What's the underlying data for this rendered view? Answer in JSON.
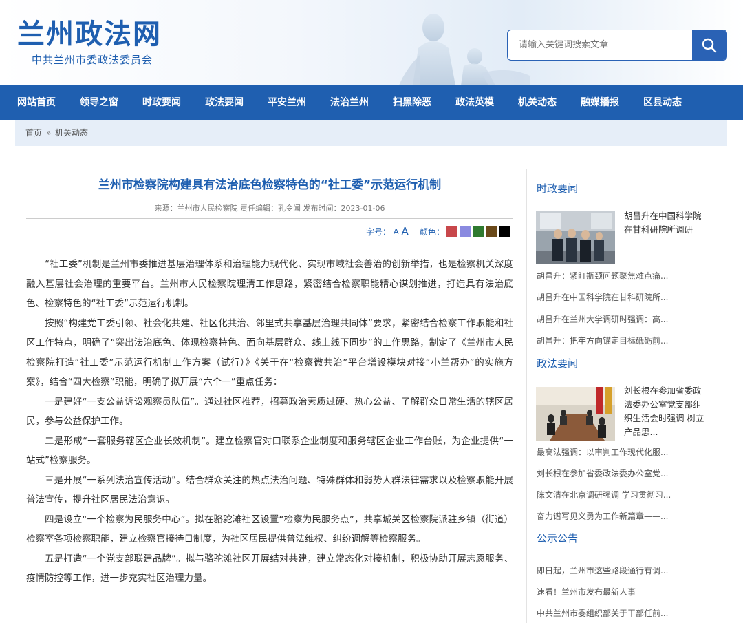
{
  "header": {
    "logo_title": "兰州政法网",
    "logo_subtitle": "中共兰州市委政法委员会",
    "search_placeholder": "请输入关键词搜索文章"
  },
  "nav": [
    "网站首页",
    "领导之窗",
    "时政要闻",
    "政法要闻",
    "平安兰州",
    "法治兰州",
    "扫黑除恶",
    "政法英模",
    "机关动态",
    "融媒播报",
    "区县动态"
  ],
  "breadcrumb": {
    "home": "首页",
    "separator": "»",
    "current": "机关动态"
  },
  "article": {
    "title": "兰州市检察院构建具有法治底色检察特色的“社工委”示范运行机制",
    "meta": "来源：兰州市人民检察院 责任编辑：孔令闻 发布时间：2023-01-06",
    "font_size_label": "字号：",
    "font_small": "A",
    "font_large": "A",
    "color_label": "颜色：",
    "colors": [
      "#c8474b",
      "#8a8ae0",
      "#2f7a2f",
      "#6b4a1a",
      "#000000"
    ],
    "paragraphs": [
      "“社工委”机制是兰州市委推进基层治理体系和治理能力现代化、实现市域社会善治的创新举措，也是检察机关深度融入基层社会治理的重要平台。兰州市人民检察院理清工作思路，紧密结合检察职能精心谋划推进，打造具有法治底色、检察特色的“社工委”示范运行机制。",
      "按照“构建党工委引领、社会化共建、社区化共治、邻里式共享基层治理共同体”要求，紧密结合检察工作职能和社区工作特点，明确了“突出法治底色、体现检察特色、面向基层群众、线上线下同步”的工作思路，制定了《兰州市人民检察院打造“社工委”示范运行机制工作方案（试行）》《关于在“检察微共治”平台增设模块对接“小兰帮办”的实施方案》，结合“四大检察”职能，明确了拟开展“六个一”重点任务：",
      "一是建好“一支公益诉讼观察员队伍”。通过社区推荐，招募政治素质过硬、热心公益、了解群众日常生活的辖区居民，参与公益保护工作。",
      "二是形成“一套服务辖区企业长效机制”。建立检察官对口联系企业制度和服务辖区企业工作台账，为企业提供“一站式”检察服务。",
      "三是开展“一系列法治宣传活动”。结合群众关注的热点法治问题、特殊群体和弱势人群法律需求以及检察职能开展普法宣传，提升社区居民法治意识。",
      "四是设立“一个检察为民服务中心”。拟在骆驼滩社区设置“检察为民服务点”，共享城关区检察院派驻乡镇（街道）检察室各项检察职能，建立检察官接待日制度，为社区居民提供普法维权、纠纷调解等检察服务。",
      "五是打造“一个党支部联建品牌”。拟与骆驼滩社区开展结对共建，建立常态化对接机制，积极协助开展志愿服务、疫情防控等工作，进一步充实社区治理力量。"
    ]
  },
  "sidebar": {
    "sections": [
      {
        "title": "时政要闻",
        "thumb_text": "胡昌升在中国科学院在甘科研院所调研",
        "links": [
          "胡昌升：紧盯瓶颈问题聚焦难点痛...",
          "胡昌升在中国科学院在甘科研院所...",
          "胡昌升在兰州大学调研时强调：高...",
          "胡昌升：把牢方向锚定目标砥砺前..."
        ]
      },
      {
        "title": "政法要闻",
        "thumb_text": "刘长根在参加省委政法委办公室党支部组织生活会时强调 树立产品思...",
        "links": [
          "最高法强调：以审判工作现代化服...",
          "刘长根在参加省委政法委办公室党...",
          "陈文清在北京调研强调 学习贯彻习...",
          "奋力谱写见义勇为工作新篇章——..."
        ]
      },
      {
        "title": "公示公告",
        "links": [
          "即日起，兰州市这些路段通行有调...",
          "速看！兰州市发布最新人事",
          "中共兰州市委组织部关于干部任前..."
        ]
      }
    ]
  }
}
